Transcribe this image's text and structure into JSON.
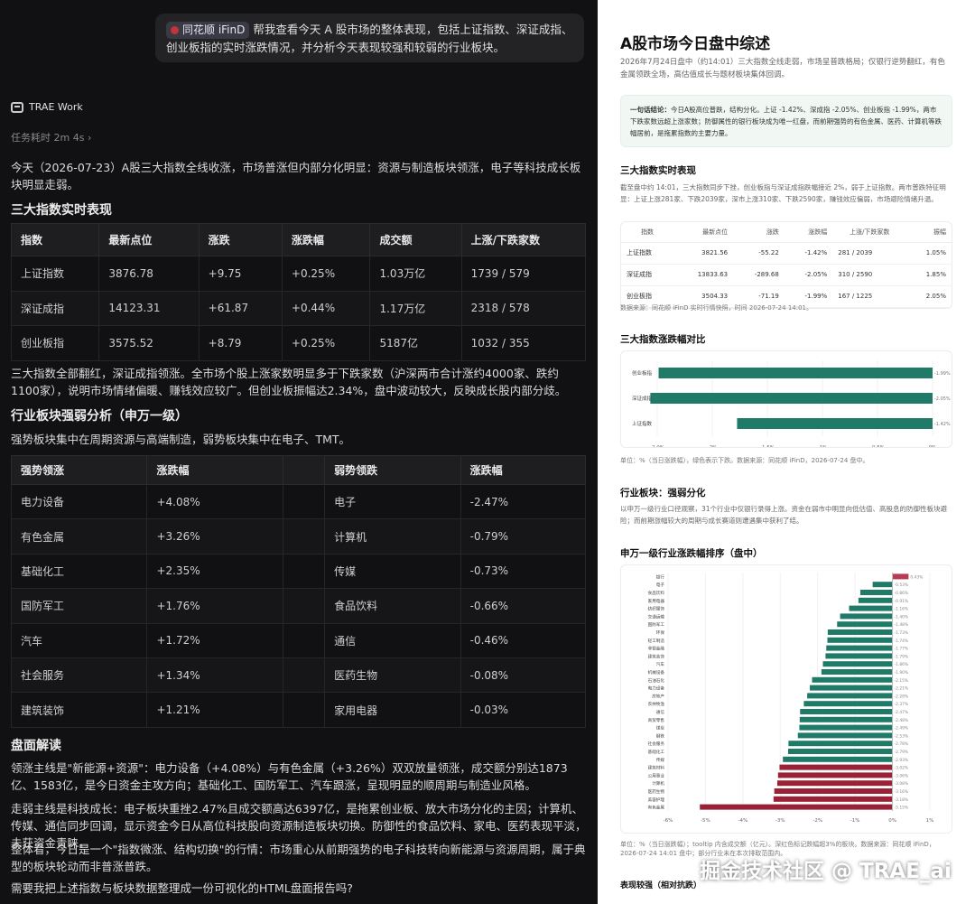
{
  "left": {
    "prompt": {
      "badge": "同花顺 iFinD",
      "text": "帮我查看今天 A 股市场的整体表现，包括上证指数、深证成指、创业板指的实时涨跌情况，并分析今天表现较强和较弱的行业板块。"
    },
    "agent_name": "TRAE Work",
    "elapsed": "任务耗时 2m 4s",
    "elapsed_chevron": "›",
    "intro": "今天（2026-07-23）A股三大指数全线收涨，市场普涨但内部分化明显：资源与制造板块领涨，电子等科技成长板块明显走弱。",
    "index_heading": "三大指数实时表现",
    "index_table": {
      "headers": [
        "指数",
        "最新点位",
        "涨跌",
        "涨跌幅",
        "成交额",
        "上涨/下跌家数"
      ],
      "rows": [
        [
          "上证指数",
          "3876.78",
          "+9.75",
          "+0.25%",
          "1.03万亿",
          "1739 / 579"
        ],
        [
          "深证成指",
          "14123.31",
          "+61.87",
          "+0.44%",
          "1.17万亿",
          "2318 / 578"
        ],
        [
          "创业板指",
          "3575.52",
          "+8.79",
          "+0.25%",
          "5187亿",
          "1032 / 355"
        ]
      ]
    },
    "index_note": "三大指数全部翻红，深证成指领涨。全市场个股上涨家数明显多于下跌家数（沪深两市合计涨约4000家、跌约1100家），说明市场情绪偏暖、赚钱效应较广。但创业板振幅达2.34%，盘中波动较大，反映成长股内部分歧。",
    "sector_heading": "行业板块强弱分析（申万一级）",
    "sector_intro": "强势板块集中在周期资源与高端制造，弱势板块集中在电子、TMT。",
    "sector_table": {
      "headers": [
        "强势领涨",
        "涨跌幅",
        "",
        "弱势领跌",
        "涨跌幅"
      ],
      "rows": [
        [
          "电力设备",
          "+4.08%",
          "",
          "电子",
          "-2.47%"
        ],
        [
          "有色金属",
          "+3.26%",
          "",
          "计算机",
          "-0.79%"
        ],
        [
          "基础化工",
          "+2.35%",
          "",
          "传媒",
          "-0.73%"
        ],
        [
          "国防军工",
          "+1.76%",
          "",
          "食品饮料",
          "-0.66%"
        ],
        [
          "汽车",
          "+1.72%",
          "",
          "通信",
          "-0.46%"
        ],
        [
          "社会服务",
          "+1.34%",
          "",
          "医药生物",
          "-0.08%"
        ],
        [
          "建筑装饰",
          "+1.21%",
          "",
          "家用电器",
          "-0.03%"
        ]
      ]
    },
    "review_heading": "盘面解读",
    "review_p1": "领涨主线是\"新能源+资源\"：电力设备（+4.08%）与有色金属（+3.26%）双双放量领涨，成交额分别达1873亿、1583亿，是今日资金主攻方向；基础化工、国防军工、汽车跟涨，呈现明显的顺周期与制造业风格。",
    "review_p2": "走弱主线是科技成长：电子板块重挫2.47%且成交额高达6397亿，是拖累创业板、放大市场分化的主因；计算机、传媒、通信同步回调，显示资金今日从高位科技股向资源制造板块切换。防御性的食品饮料、家电、医药表现平淡，未获资金青睐。",
    "review_p3": "整体看，今日是一个\"指数微涨、结构切换\"的行情：市场重心从前期强势的电子科技转向新能源与资源周期，属于典型的板块轮动而非普涨普跌。",
    "closing": "需要我把上述指数与板块数据整理成一份可视化的HTML盘面报告吗?"
  },
  "right": {
    "title": "A股市场今日盘中综述",
    "meta": "2026年7月24日盘中（约14:01）三大指数全线走弱，市场呈普跌格局；仅银行逆势翻红，有色金属领跌全场，高估值成长与题材板块集体回调。",
    "summary_label": "一句话结论：",
    "summary": "今日A股高位普跌，结构分化。上证 -1.42%、深成指 -2.05%、创业板指 -1.99%，两市下跌家数远超上涨家数；防御属性的银行板块成为唯一红盘，而前期强势的有色金属、医药、计算机等跌幅居前，是拖累指数的主要力量。",
    "index_heading": "三大指数实时表现",
    "index_desc": "截至盘中约 14:01，三大指数同步下挫，创业板指与深证成指跌幅接近 2%，弱于上证指数。两市普跌特征明显：上证上涨281家、下跌2039家，深市上涨310家、下跌2590家，赚钱效应偏弱，市场避险情绪升温。",
    "index_table": {
      "headers": [
        "指数",
        "最新点位",
        "涨跌",
        "涨跌幅",
        "上涨/下跌家数",
        "振幅"
      ],
      "rows": [
        [
          "上证指数",
          "3821.56",
          "-55.22",
          "-1.42%",
          "281 / 2039",
          "1.05%"
        ],
        [
          "深证成指",
          "13833.63",
          "-289.68",
          "-2.05%",
          "310 / 2590",
          "1.85%"
        ],
        [
          "创业板指",
          "3504.33",
          "-71.19",
          "-1.99%",
          "167 / 1225",
          "2.05%"
        ]
      ]
    },
    "index_source": "数据来源：同花顺 iFinD 实时行情快照，时间 2026-07-24 14:01。",
    "bar_heading": "三大指数涨跌幅对比",
    "bar_note": "单位：%（当日涨跌幅），绿色表示下跌。数据来源：同花顺 iFinD，2026-07-24 盘中。",
    "sector_heading": "行业板块：强弱分化",
    "sector_desc": "以申万一级行业口径观察，31个行业中仅银行录得上涨。资金在弱市中明显向低估值、高股息的防御性板块避险；而前期涨幅较大的周期与成长赛道则遭遇集中获利了结。",
    "rank_heading": "申万一级行业涨跌幅排序（盘中）",
    "rank_note": "单位：%（当日涨跌幅）；tooltip 内含成交额（亿元）。深红色标记跌幅超3%的板块。数据来源：同花顺 iFinD，2026-07-24 14:01 盘中；部分行业未在本次排取范围内。",
    "bottom_heading": "表现较强（相对抗跌）"
  },
  "watermark": "掘金技术社区 @ TRAE_ai",
  "colors": {
    "green": "#1f7a68",
    "red": "#9a2237",
    "pink": "#b83b55"
  },
  "chart_data": [
    {
      "type": "bar",
      "orientation": "horizontal",
      "title": "三大指数涨跌幅对比",
      "categories": [
        "创业板指",
        "深证成指",
        "上证指数"
      ],
      "values": [
        -1.99,
        -2.05,
        -1.42
      ],
      "value_labels": [
        "-1.99%",
        "-2.05%",
        "-1.42%"
      ],
      "xlim": [
        -2.0,
        0
      ],
      "xticks": [
        "-2.0%",
        "-2%",
        "-1.5%",
        "-1%",
        "-0.5%",
        "0%"
      ]
    },
    {
      "type": "bar",
      "orientation": "horizontal",
      "title": "申万一级行业涨跌幅排序（盘中）",
      "categories": [
        "银行",
        "电子",
        "食品饮料",
        "家用电器",
        "纺织服饰",
        "交通运输",
        "国防军工",
        "环保",
        "轻工制造",
        "非银金融",
        "建筑装饰",
        "汽车",
        "机械设备",
        "石油石化",
        "电力设备",
        "房地产",
        "农林牧渔",
        "通信",
        "商贸零售",
        "煤炭",
        "钢铁",
        "社会服务",
        "基础化工",
        "传媒",
        "建筑材料",
        "公用事业",
        "计算机",
        "医药生物",
        "美容护理",
        "有色金属"
      ],
      "values": [
        0.43,
        -0.53,
        -0.86,
        -0.91,
        -1.16,
        -1.4,
        -1.48,
        -1.73,
        -1.74,
        -1.77,
        -1.79,
        -1.86,
        -1.9,
        -2.15,
        -2.21,
        -2.28,
        -2.37,
        -2.47,
        -2.48,
        -2.49,
        -2.53,
        -2.78,
        -2.79,
        -2.93,
        -3.02,
        -3.06,
        -3.08,
        -3.16,
        -3.18,
        -5.15
      ],
      "value_labels": [
        "0.43%",
        "-0.53%",
        "-0.86%",
        "-0.91%",
        "-1.16%",
        "-1.40%",
        "-1.48%",
        "-1.73%",
        "-1.74%",
        "-1.77%",
        "-1.79%",
        "-1.86%",
        "-1.90%",
        "-2.15%",
        "-2.21%",
        "-2.28%",
        "-2.37%",
        "-2.47%",
        "-2.48%",
        "-2.49%",
        "-2.53%",
        "-2.78%",
        "-2.79%",
        "-2.93%",
        "-3.02%",
        "-3.06%",
        "-3.08%",
        "-3.16%",
        "-3.18%",
        "-5.15%"
      ],
      "xlim": [
        -6,
        1
      ],
      "xticks": [
        "-6%",
        "-5%",
        "-4%",
        "-3%",
        "-2%",
        "-1%",
        "0%",
        "1%"
      ]
    }
  ]
}
